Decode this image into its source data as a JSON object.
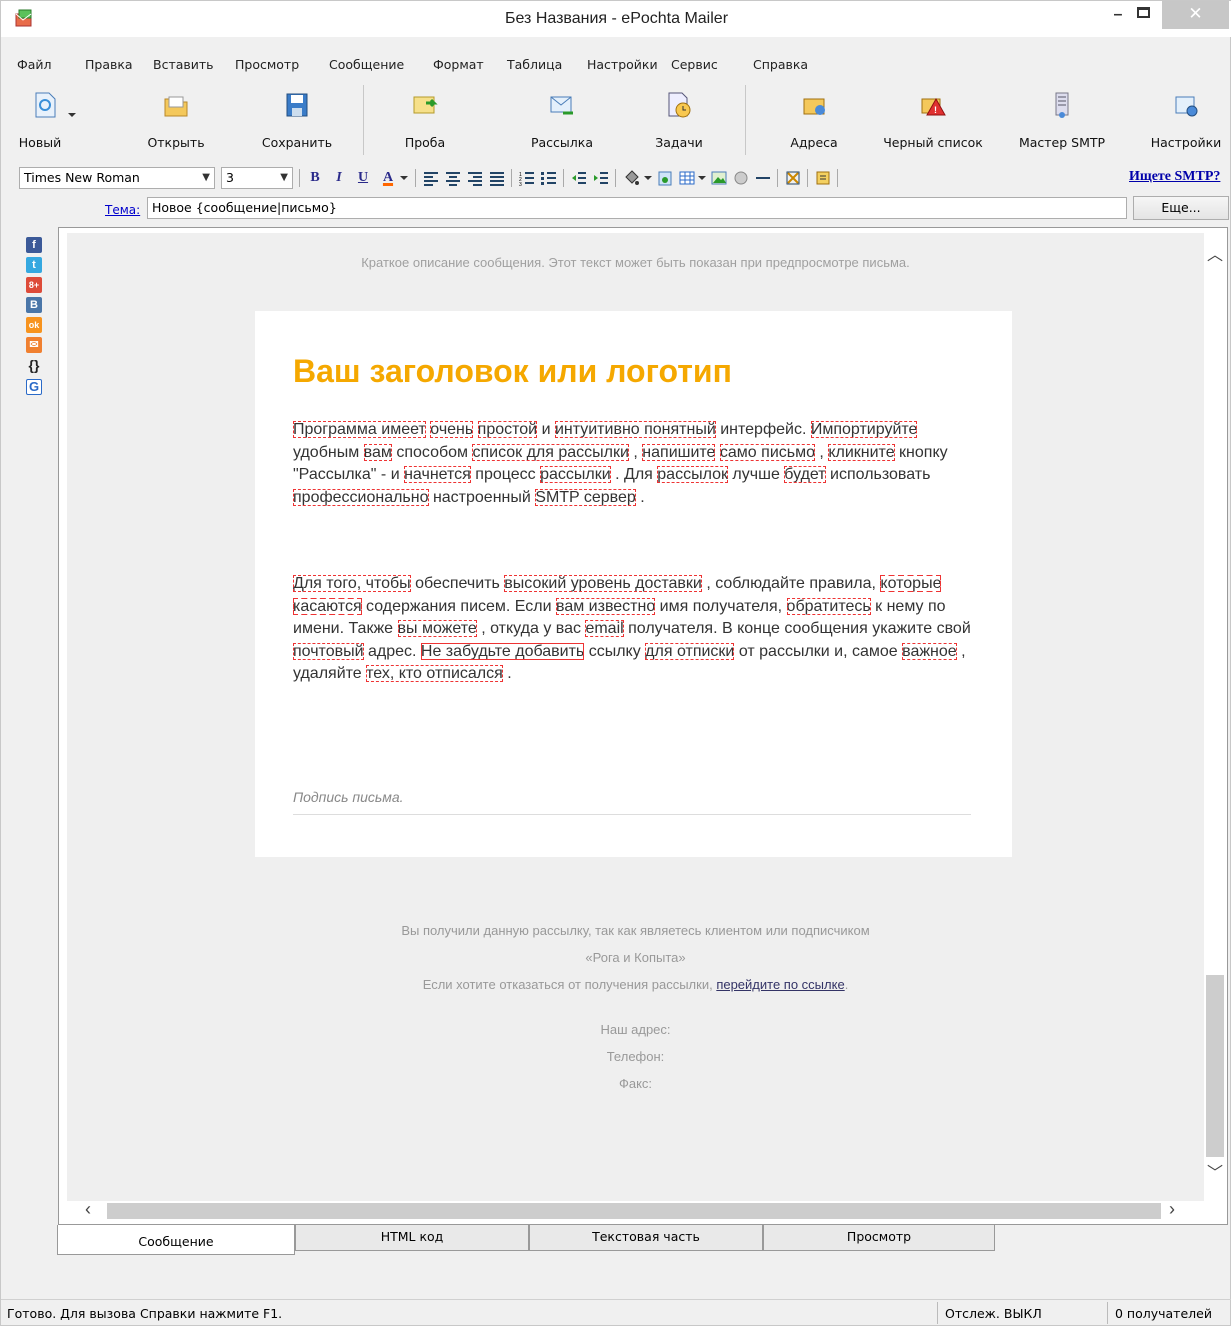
{
  "window": {
    "title": "Без Названия - ePochta Mailer",
    "minimize": "–",
    "close": "✕"
  },
  "menu": [
    "Файл",
    "Правка",
    "Вставить",
    "Просмотр",
    "Сообщение",
    "Формат",
    "Таблица",
    "Настройки",
    "Сервис",
    "Справка"
  ],
  "toolbar": {
    "new": "Новый",
    "open": "Открыть",
    "save": "Сохранить",
    "test": "Проба",
    "mailing": "Рассылка",
    "tasks": "Задачи",
    "addresses": "Адреса",
    "blacklist": "Черный список",
    "smtp_wizard": "Мастер SMTP",
    "settings": "Настройки"
  },
  "format": {
    "font": "Times New Roman",
    "size": "3",
    "bold": "B",
    "italic": "I",
    "underline": "U",
    "color": "A",
    "smtp_link": "Ищете SMTP?"
  },
  "subject": {
    "label": "Тема:",
    "value": "Новое {сообщение|письмо}",
    "more": "Еще..."
  },
  "social": [
    "f",
    "t",
    "8+",
    "B",
    "ok",
    "✉",
    "{}",
    "G"
  ],
  "editor": {
    "preheader": "Краткое описание сообщения. Этот текст может быть показан при предпросмотре письма.",
    "headline": "Ваш заголовок или логотип",
    "p1": [
      [
        "Программа имеет",
        1
      ],
      [
        " ",
        0
      ],
      [
        "очень",
        1
      ],
      [
        " ",
        0
      ],
      [
        "простой",
        1
      ],
      [
        " и ",
        0
      ],
      [
        "интуитивно понятный",
        1
      ],
      [
        " интерфейс. ",
        0
      ],
      [
        "Импортируйте",
        1
      ],
      [
        " удобным ",
        0
      ],
      [
        "вам",
        1
      ],
      [
        " способом ",
        0
      ],
      [
        "список для рассылки",
        1
      ],
      [
        " , ",
        0
      ],
      [
        "напишите",
        1
      ],
      [
        " ",
        0
      ],
      [
        "само письмо",
        1
      ],
      [
        " , ",
        0
      ],
      [
        "кликните",
        1
      ],
      [
        " кнопку \"Рассылка\" - и ",
        0
      ],
      [
        "начнется",
        1
      ],
      [
        " процесс ",
        0
      ],
      [
        "рассылки",
        1
      ],
      [
        " . Для ",
        0
      ],
      [
        "рассылок",
        1
      ],
      [
        " лучше ",
        0
      ],
      [
        "будет",
        1
      ],
      [
        " использовать ",
        0
      ],
      [
        "профессионально",
        1
      ],
      [
        " настроенный ",
        0
      ],
      [
        "SMTP сервер",
        1
      ],
      [
        " .",
        0
      ]
    ],
    "p2": [
      [
        "Для того, чтобы",
        1
      ],
      [
        " обеспечить ",
        0
      ],
      [
        "высокий уровень доставки",
        1
      ],
      [
        " , соблюдайте правила, ",
        0
      ],
      [
        "которые касаются",
        1
      ],
      [
        " содержания писем. Если ",
        0
      ],
      [
        "вам известно",
        1
      ],
      [
        " имя получателя, ",
        0
      ],
      [
        "обратитесь",
        1
      ],
      [
        " к нему по имени. Также ",
        0
      ],
      [
        "вы можете",
        1
      ],
      [
        " , откуда у вас ",
        0
      ],
      [
        "email",
        1
      ],
      [
        " получателя. В конце сообщения укажите свой ",
        0
      ],
      [
        "почтовый",
        1
      ],
      [
        " адрес. ",
        0
      ],
      [
        "Не забудьте добавить",
        2
      ],
      [
        " ссылку ",
        0
      ],
      [
        "для отписки",
        1
      ],
      [
        " от рассылки и, самое ",
        0
      ],
      [
        "важное",
        1
      ],
      [
        " , удаляйте ",
        0
      ],
      [
        "тех, кто отписался",
        1
      ],
      [
        " .",
        0
      ]
    ],
    "signature": "Подпись письма.",
    "footer": {
      "line1": "Вы получили данную рассылку, так как являетесь клиентом или подписчиком",
      "line2": "«Рога и Копыта»",
      "line3": "Если хотите отказаться от получения рассылки, ",
      "link": "перейдите по ссылке",
      "line3_end": ".",
      "address": "Наш адрес:",
      "phone": "Телефон:",
      "fax": "Факс:"
    }
  },
  "tabs": [
    "Сообщение",
    "HTML код",
    "Текстовая часть",
    "Просмотр"
  ],
  "status": {
    "ready": "Готово. Для вызова Справки нажмите F1.",
    "tracking": "Отслеж. ВЫКЛ",
    "recipients": "0 получателей"
  },
  "colors": {
    "headline": "#f5a800",
    "spell_mark": "#e33333",
    "link": "#0000aa"
  }
}
